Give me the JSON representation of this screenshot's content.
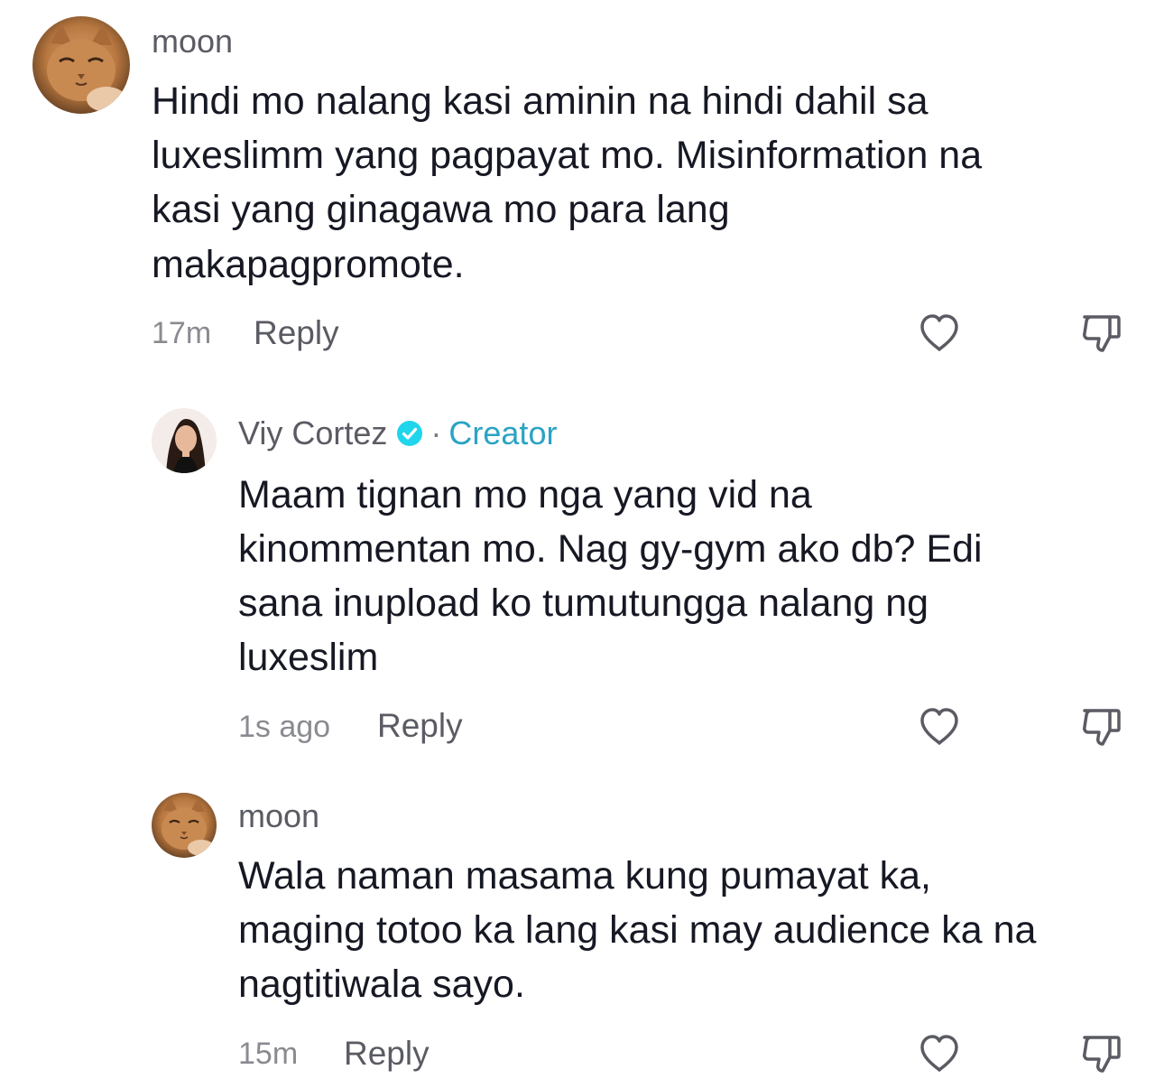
{
  "comments": [
    {
      "username": "moon",
      "lines": [
        "Hindi mo nalang kasi aminin na hindi dahil sa",
        "luxeslimm yang pagpayat mo. Misinformation na",
        "kasi yang ginagawa mo para lang",
        "makapagpromote."
      ],
      "time": "17m",
      "reply_label": "Reply",
      "avatar_icon": "cat-avatar"
    },
    {
      "username": "Viy Cortez",
      "verified_icon": "verified-badge-icon",
      "separator": "·",
      "badge": "Creator",
      "lines": [
        "Maam tignan mo nga yang vid na",
        "kinommentan mo. Nag gy-gym ako db? Edi",
        "sana inupload ko tumutungga nalang ng",
        "luxeslim"
      ],
      "time": "1s ago",
      "reply_label": "Reply",
      "avatar_icon": "woman-avatar"
    },
    {
      "username": "moon",
      "lines": [
        "Wala naman masama kung pumayat ka,",
        "maging totoo ka lang kasi may audience ka na",
        "nagtitiwala sayo."
      ],
      "time": "15m",
      "reply_label": "Reply",
      "avatar_icon": "cat-avatar"
    }
  ],
  "colors": {
    "text": "#161823",
    "secondary": "#5a5b63",
    "muted": "#8a8b91",
    "creator": "#2aa3c4",
    "verified": "#20d5ec"
  },
  "icons": {
    "like": "heart-outline-icon",
    "dislike": "thumbs-down-outline-icon"
  }
}
